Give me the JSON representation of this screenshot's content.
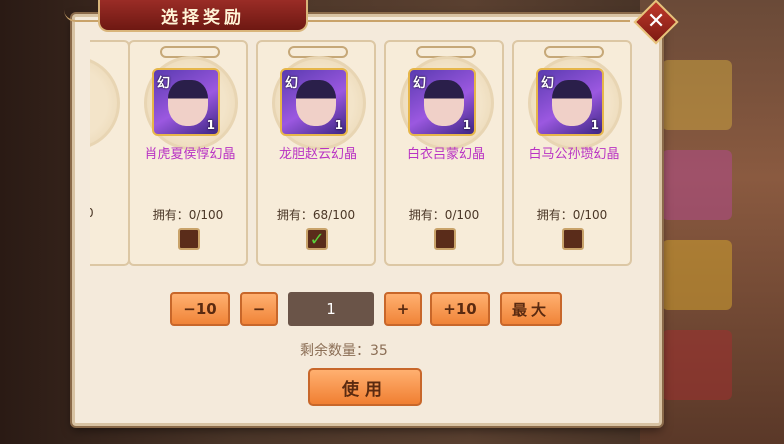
{
  "dialog": {
    "title": "选择奖励",
    "close_symbol": "✕"
  },
  "cards": [
    {
      "name": "",
      "owned": "0",
      "checked": false
    },
    {
      "name": "肖虎夏侯惇幻晶",
      "owned": "拥有：0/100",
      "checked": false,
      "icon_label": "幻",
      "quantity": "1"
    },
    {
      "name": "龙胆赵云幻晶",
      "owned": "拥有：68/100",
      "checked": true,
      "icon_label": "幻",
      "quantity": "1"
    },
    {
      "name": "白衣吕蒙幻晶",
      "owned": "拥有：0/100",
      "checked": false,
      "icon_label": "幻",
      "quantity": "1"
    },
    {
      "name": "白马公孙瓒幻晶",
      "owned": "拥有：0/100",
      "checked": false,
      "icon_label": "幻",
      "quantity": "1"
    }
  ],
  "controls": {
    "minus_ten": "−10",
    "minus": "−",
    "quantity": "1",
    "plus": "+",
    "plus_ten": "+10",
    "max": "最大"
  },
  "remaining": "剩余数量：35",
  "use_button": "使用",
  "check_mark": "✓"
}
